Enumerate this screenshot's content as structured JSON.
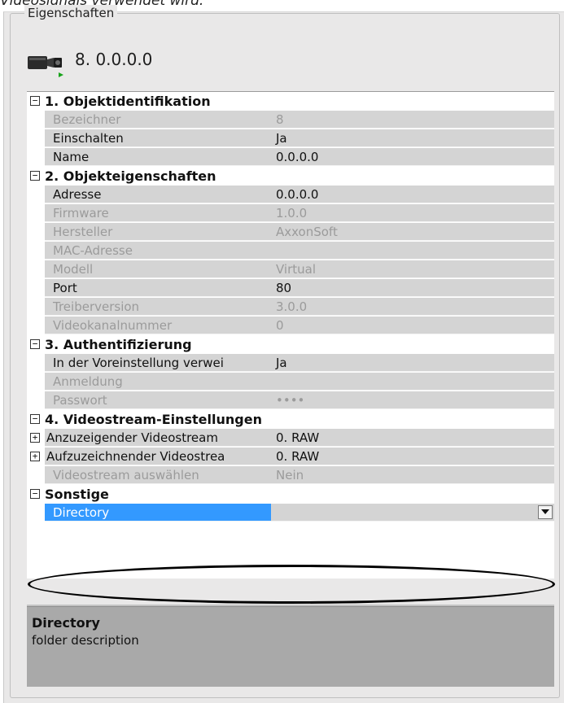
{
  "caption": "Videosignals verwendet wird.",
  "panel": {
    "legend": "Eigenschaften",
    "device_title": "8. 0.0.0.0"
  },
  "grid": {
    "categories": [
      {
        "label": "1. Objektidentifikation",
        "rows": [
          {
            "name": "Bezeichner",
            "value": "8",
            "enabled": false
          },
          {
            "name": "Einschalten",
            "value": "Ja",
            "enabled": true
          },
          {
            "name": "Name",
            "value": "0.0.0.0",
            "enabled": true
          }
        ]
      },
      {
        "label": "2. Objekteigenschaften",
        "rows": [
          {
            "name": "Adresse",
            "value": "0.0.0.0",
            "enabled": true
          },
          {
            "name": "Firmware",
            "value": "1.0.0",
            "enabled": false
          },
          {
            "name": "Hersteller",
            "value": "AxxonSoft",
            "enabled": false
          },
          {
            "name": "MAC-Adresse",
            "value": "",
            "enabled": false
          },
          {
            "name": "Modell",
            "value": "Virtual",
            "enabled": false
          },
          {
            "name": "Port",
            "value": "80",
            "enabled": true
          },
          {
            "name": "Treiberversion",
            "value": "3.0.0",
            "enabled": false
          },
          {
            "name": "Videokanalnummer",
            "value": "0",
            "enabled": false
          }
        ]
      },
      {
        "label": "3. Authentifizierung",
        "rows": [
          {
            "name": "In der Voreinstellung verwei",
            "value": "Ja",
            "enabled": true
          },
          {
            "name": "Anmeldung",
            "value": "",
            "enabled": false
          },
          {
            "name": "Passwort",
            "value": "••••",
            "enabled": false
          }
        ]
      },
      {
        "label": "4. Videostream-Einstellungen",
        "rows": [
          {
            "name": "Anzuzeigender Videostream",
            "value": "0. RAW",
            "enabled": true,
            "expandable": true
          },
          {
            "name": "Aufzuzeichnender Videostrea",
            "value": "0. RAW",
            "enabled": true,
            "expandable": true
          },
          {
            "name": "Videostream auswählen",
            "value": "Nein",
            "enabled": false
          }
        ]
      },
      {
        "label": "Sonstige",
        "rows": [
          {
            "name": "Directory",
            "value": "",
            "enabled": true,
            "selected": true,
            "dropdown": true
          }
        ]
      }
    ]
  },
  "description": {
    "title": "Directory",
    "text": "folder description"
  },
  "icons": {
    "collapse": "minus-box-icon",
    "expand": "plus-box-icon",
    "device": "camera-icon",
    "dropdown": "chevron-down-icon"
  },
  "colors": {
    "selected": "#3399ff",
    "cell_bg": "#d4d4d4",
    "description_bg": "#a9a9a9"
  }
}
